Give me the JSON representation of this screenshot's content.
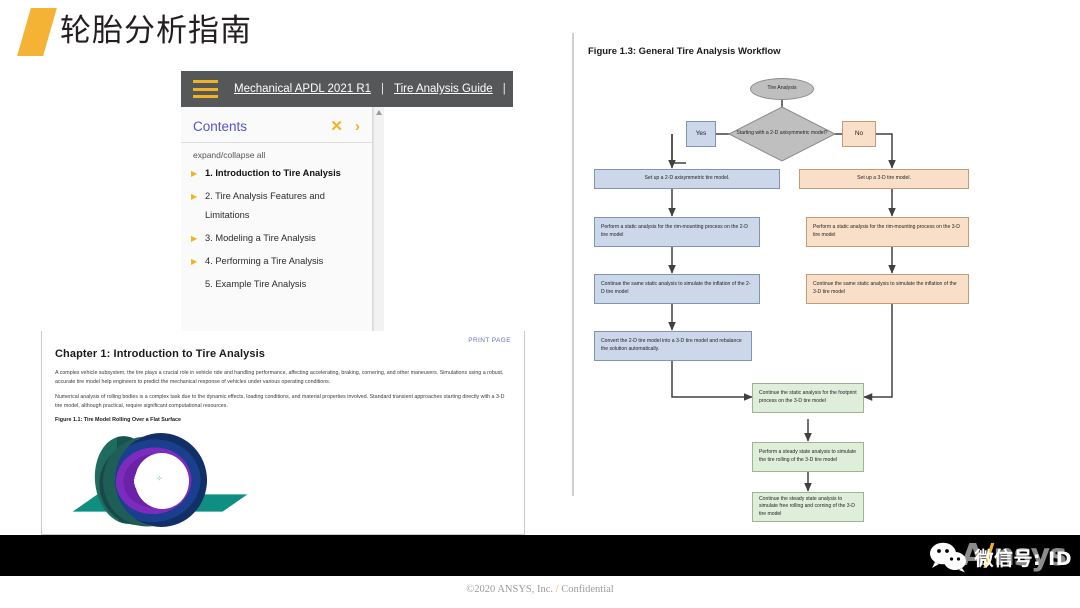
{
  "slide": {
    "title": "轮胎分析指南",
    "accent_color": "#f5b335"
  },
  "help_viewer": {
    "hamburger_icon": "hamburger-menu-icon",
    "breadcrumb": [
      {
        "label": "Mechanical APDL 2021 R1"
      },
      {
        "label": "Tire Analysis Guide"
      }
    ],
    "separator": "|",
    "contents": {
      "title": "Contents",
      "close_icon": "✕",
      "expand_icon": "›",
      "expand_collapse": "expand/collapse all",
      "items": [
        {
          "label": "1. Introduction to Tire Analysis",
          "has_toggle": true,
          "active": true
        },
        {
          "label": "2. Tire Analysis Features and Limitations",
          "has_toggle": true,
          "active": false
        },
        {
          "label": "3. Modeling a Tire Analysis",
          "has_toggle": true,
          "active": false
        },
        {
          "label": "4. Performing a Tire Analysis",
          "has_toggle": true,
          "active": false
        },
        {
          "label": "5. Example Tire Analysis",
          "has_toggle": false,
          "active": false
        }
      ]
    }
  },
  "document": {
    "print_link": "PRINT PAGE",
    "heading": "Chapter 1: Introduction to Tire Analysis",
    "paragraphs": [
      "A complex vehicle subsystem, the tire plays a crucial role in vehicle ride and handling performance, affecting accelerating, braking, cornering, and other maneuvers. Simulations using a robust, accurate tire model help engineers to predict the mechanical response of vehicles under various operating conditions.",
      "Numerical analysis of rolling bodies is a complex task due to the dynamic effects, loading conditions, and material properties involved. Standard transient approaches starting directly with a 3-D tire model, although practical, require significant computational resources."
    ],
    "figure_caption": "Figure 1.1: Tire Model Rolling Over a Flat Surface",
    "figure_alt": "tire-model-3d-render"
  },
  "flowchart": {
    "title": "Figure 1.3: General Tire Analysis Workflow",
    "start_node": "Tire Analysis",
    "decision": "Starting with a 2-D axisymmetric model?",
    "branch_yes": "Yes",
    "branch_no": "No",
    "left_branch": [
      "Set up a 2-D axisymmetric tire model.",
      "Perform a static analysis for the rim-mounting process on the 2-D tire model",
      "Continue the same static analysis to simulate the inflation of the 2-D tire model",
      "Convert the 2-D tire model into a 3-D tire model and rebalance the solution automatically."
    ],
    "right_branch": [
      "Set up a 3-D tire model.",
      "Perform a static analysis for the rim-mounting process on the 3-D tire model",
      "Continue the same static analysis to simulate the inflation of the 3-D tire model"
    ],
    "merged": [
      "Continue the static analysis for the footprint process on the 3-D tire model",
      "Perform a steady state analysis to simulate the tire rolling of the 3-D tire model",
      "Continue the steady state analysis to simulate free rolling and corning of the 3-D tire model"
    ],
    "colors": {
      "blue": "#ccd7ea",
      "peach": "#fadfc8",
      "green": "#dfeedb",
      "gray": "#bfbfbf"
    }
  },
  "footer": {
    "wechat_icon": "wechat-icon",
    "wechat_text": "微信号: ID",
    "watermark_prefix": "A",
    "watermark_slash": "/",
    "watermark_suffix": "nsys",
    "copyright_prefix": "©2020 ANSYS, Inc. ",
    "copyright_slash": "/",
    "copyright_suffix": " Confidential"
  }
}
